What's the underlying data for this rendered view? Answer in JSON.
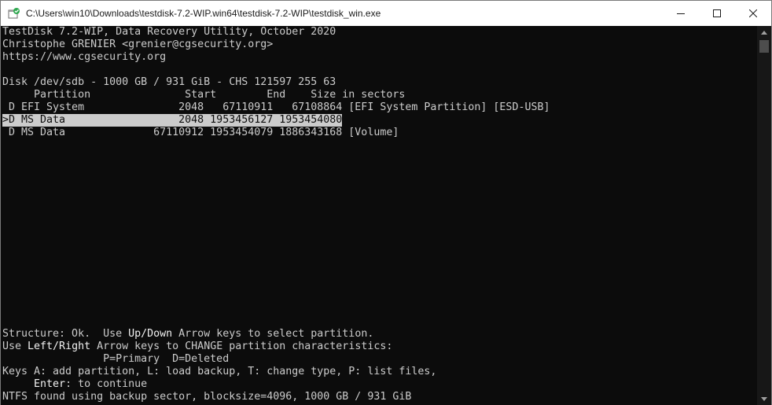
{
  "window": {
    "title": "C:\\Users\\win10\\Downloads\\testdisk-7.2-WIP.win64\\testdisk-7.2-WIP\\testdisk_win.exe",
    "icon": "console-app-icon",
    "controls": [
      "minimize-icon",
      "maximize-icon",
      "close-icon"
    ]
  },
  "console": {
    "header": {
      "line1": "TestDisk 7.2-WIP, Data Recovery Utility, October 2020",
      "line2": "Christophe GRENIER <grenier@cgsecurity.org>",
      "line3": "https://www.cgsecurity.org"
    },
    "disk": "Disk /dev/sdb - 1000 GB / 931 GiB - CHS 121597 255 63",
    "columns": "     Partition               Start        End    Size in sectors",
    "partitions": [
      {
        "text": " D EFI System               2048   67110911   67108864 [EFI System Partition] [ESD-USB]",
        "selected": false
      },
      {
        "text": ">D MS Data                  2048 1953456127 1953454080",
        "selected": true
      },
      {
        "text": " D MS Data              67110912 1953454079 1886343168 [Volume]",
        "selected": false
      }
    ],
    "help": {
      "l1a": "Structure: Ok.  Use ",
      "l1b": "Up/Down",
      "l1c": " Arrow keys to select partition.",
      "l2a": "Use ",
      "l2b": "Left/Right",
      "l2c": " Arrow keys to CHANGE partition characteristics:",
      "l3": "                P=Primary  D=Deleted",
      "l4": "Keys A: add partition, L: load backup, T: change type, P: list files,",
      "l5a": "     ",
      "l5b": "Enter",
      "l5c": ": to continue",
      "l6": "NTFS found using backup sector, blocksize=4096, 1000 GB / 931 GiB"
    }
  },
  "colors": {
    "console_bg": "#0c0c0c",
    "console_fg": "#cccccc",
    "selection_bg": "#cccccc",
    "titlebar_bg": "#ffffff"
  }
}
